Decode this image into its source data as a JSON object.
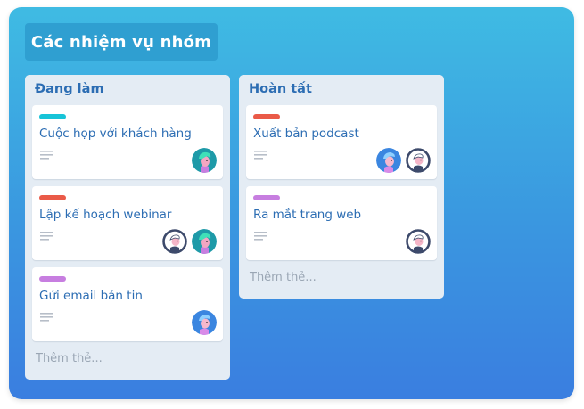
{
  "board": {
    "title": "Các nhiệm vụ nhóm"
  },
  "colors": {
    "cyan": "#17c4d8",
    "red": "#ea5a48",
    "purple": "#c77ee0"
  },
  "lists": [
    {
      "title": "Đang làm",
      "add_card": "Thêm thẻ...",
      "cards": [
        {
          "title": "Cuộc họp với khách hàng",
          "label_color": "#17c4d8",
          "members": [
            "teal-hair-avatar"
          ]
        },
        {
          "title": "Lập kế hoạch webinar",
          "label_color": "#ea5a48",
          "members": [
            "dark-outline-avatar",
            "teal-hair-avatar"
          ]
        },
        {
          "title": "Gửi email bản tin",
          "label_color": "#c77ee0",
          "members": [
            "blue-avatar"
          ]
        }
      ]
    },
    {
      "title": "Hoàn tất",
      "add_card": "Thêm thẻ...",
      "cards": [
        {
          "title": "Xuất bản podcast",
          "label_color": "#ea5a48",
          "members": [
            "blue-avatar",
            "dark-outline-avatar"
          ]
        },
        {
          "title": "Ra mắt trang web",
          "label_color": "#c77ee0",
          "members": [
            "dark-outline-avatar"
          ]
        }
      ]
    }
  ]
}
